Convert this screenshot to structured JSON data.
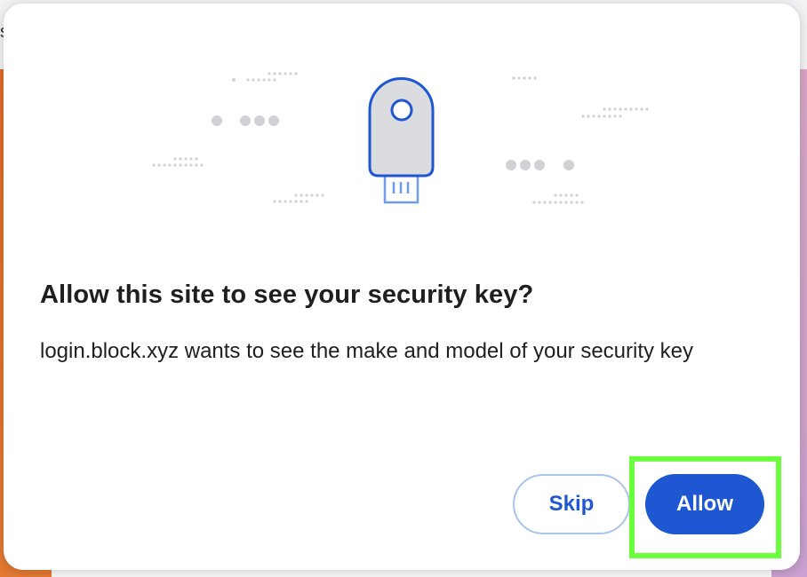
{
  "dialog": {
    "title": "Allow this site to see your security key?",
    "message": "login.block.xyz wants to see the make and model of your security key",
    "skip_label": "Skip",
    "allow_label": "Allow"
  },
  "illustration": {
    "icon": "usb-security-key-icon",
    "key_color": "#dadce0",
    "key_outline": "#1e57d1",
    "connector_color": "#6f9de8"
  },
  "colors": {
    "accent": "#1e57d1",
    "highlight": "#6aff3c"
  }
}
